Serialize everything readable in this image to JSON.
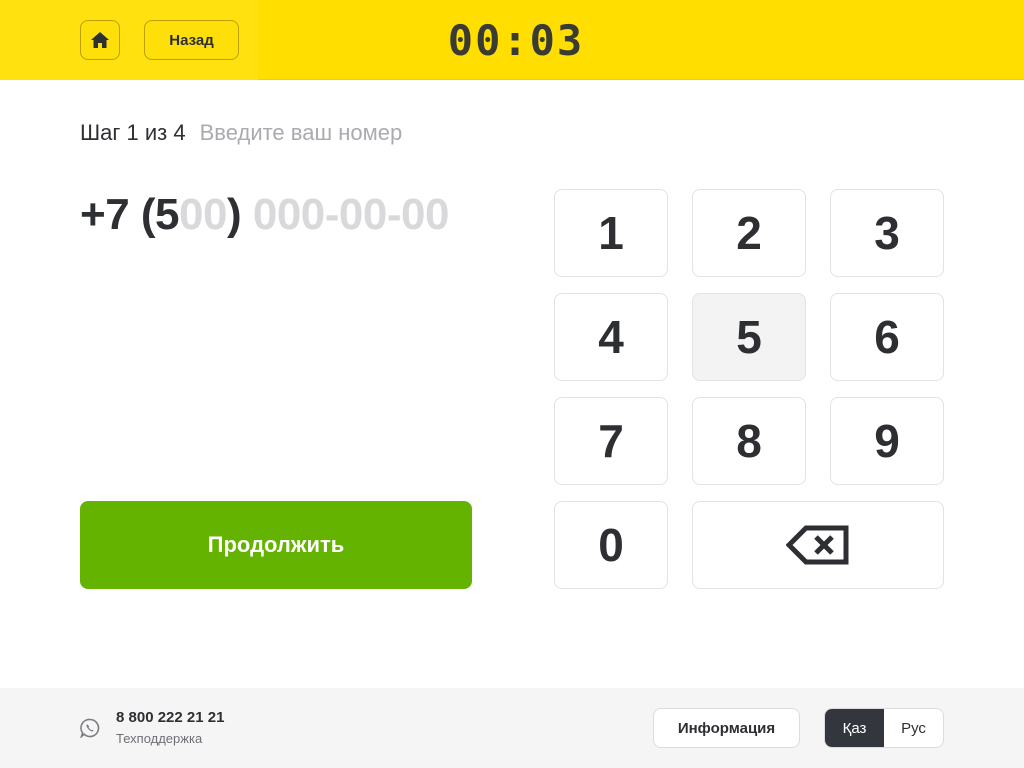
{
  "header": {
    "home_icon": "home-icon",
    "back_label": "Назад",
    "timer": "00:03"
  },
  "step": {
    "label": "Шаг 1 из 4",
    "hint": "Введите ваш номер"
  },
  "phone": {
    "prefix": "+7 (5",
    "area_rest": "00",
    "close_paren": ")",
    "placeholder": " 000-00-00",
    "entered_digits": "5"
  },
  "actions": {
    "continue_label": "Продолжить"
  },
  "keypad": {
    "keys": [
      "1",
      "2",
      "3",
      "4",
      "5",
      "6",
      "7",
      "8",
      "9",
      "0"
    ],
    "pressed_key": "5",
    "backspace_icon": "backspace-icon"
  },
  "footer": {
    "support_icon": "whatsapp-icon",
    "support_phone": "8 800 222 21 21",
    "support_label": "Техподдержка",
    "info_label": "Информация",
    "languages": [
      "Қаз",
      "Рус"
    ],
    "active_language": "Қаз"
  },
  "colors": {
    "header_bg": "#ffde00",
    "accent_green": "#63b300",
    "text_dark": "#2d2f33",
    "placeholder_gray": "#d9d9dc",
    "active_lang_bg": "#33363c"
  }
}
